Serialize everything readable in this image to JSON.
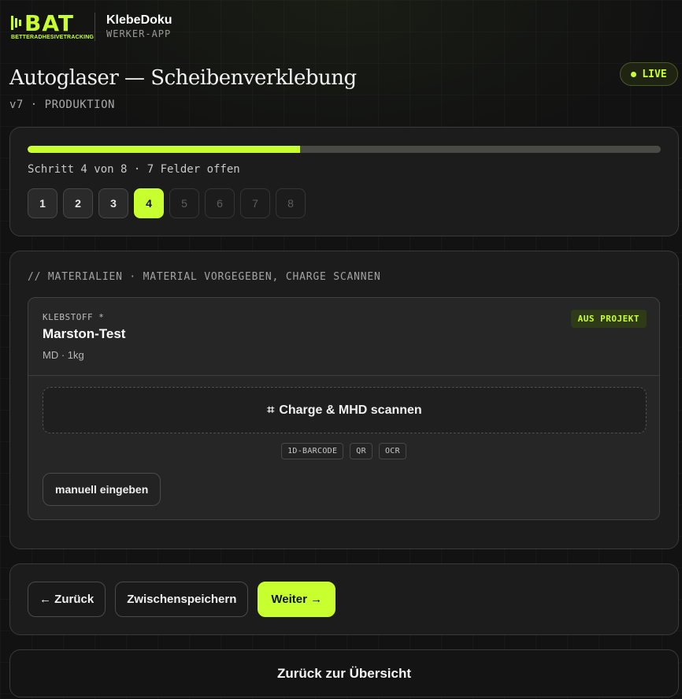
{
  "brand": {
    "logo_text": "BAT",
    "logo_tagline": "BETTERADHESIVETRACKING",
    "app_name": "KlebeDoku",
    "app_subtitle": "WERKER-APP"
  },
  "page": {
    "title": "Autoglaser — Scheibenverklebung",
    "version_line": "v7 · PRODUKTION",
    "status_badge": "LIVE"
  },
  "progress": {
    "percent": 43,
    "text": "Schritt 4 von 8 · 7 Felder offen",
    "steps": [
      "1",
      "2",
      "3",
      "4",
      "5",
      "6",
      "7",
      "8"
    ],
    "current_step": 4
  },
  "materials": {
    "section_label": "// MATERIALIEN · MATERIAL VORGEGEBEN, CHARGE SCANNEN",
    "item": {
      "kind_label": "KLEBSTOFF *",
      "name": "Marston-Test",
      "detail": "MD · 1kg",
      "badge": "AUS PROJEKT",
      "scan_label": "Charge & MHD scannen",
      "scan_types": [
        "1D-BARCODE",
        "QR",
        "OCR"
      ],
      "manual_label": "manuell eingeben"
    }
  },
  "navigation": {
    "back_label": "← Zurück",
    "save_label": "Zwischenspeichern",
    "next_label": "Weiter →"
  },
  "footer": {
    "overview_label": "Zurück zur Übersicht"
  },
  "colors": {
    "accent": "#c8ff2e",
    "background": "#121212",
    "card": "#1c1c1c"
  },
  "icons": {
    "scan": "scan-frame-icon",
    "live": "status-dot-icon"
  }
}
